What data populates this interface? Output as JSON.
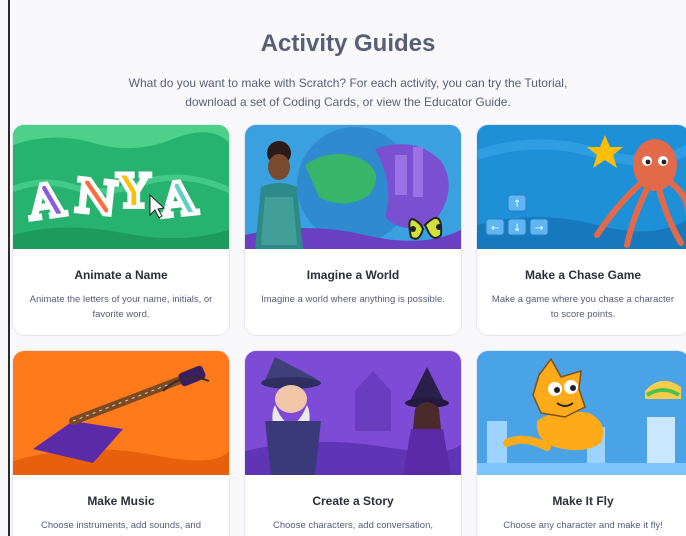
{
  "header": {
    "title": "Activity Guides",
    "subtitle": "What do you want to make with Scratch? For each activity, you can try the Tutorial, download a set of Coding Cards, or view the Educator Guide."
  },
  "cards": [
    {
      "title": "Animate a Name",
      "description": "Animate the letters of your name, initials, or favorite word.",
      "image_text": "ANYA"
    },
    {
      "title": "Imagine a World",
      "description": "Imagine a world where anything is possible."
    },
    {
      "title": "Make a Chase Game",
      "description": "Make a game where you chase a character to score points."
    },
    {
      "title": "Make Music",
      "description": "Choose instruments, add sounds, and"
    },
    {
      "title": "Create a Story",
      "description": "Choose characters, add conversation,"
    },
    {
      "title": "Make It Fly",
      "description": "Choose any character and make it fly!"
    }
  ],
  "colors": {
    "heading": "#575e75",
    "card_border": "#e3e6ee",
    "anya_bg": "#27b36f",
    "world_bg": "#3aa0e0",
    "chase_bg": "#1e90d8",
    "music_bg": "#ff7a1a",
    "story_bg": "#7d4bd6",
    "fly_bg": "#4aa3e6"
  }
}
